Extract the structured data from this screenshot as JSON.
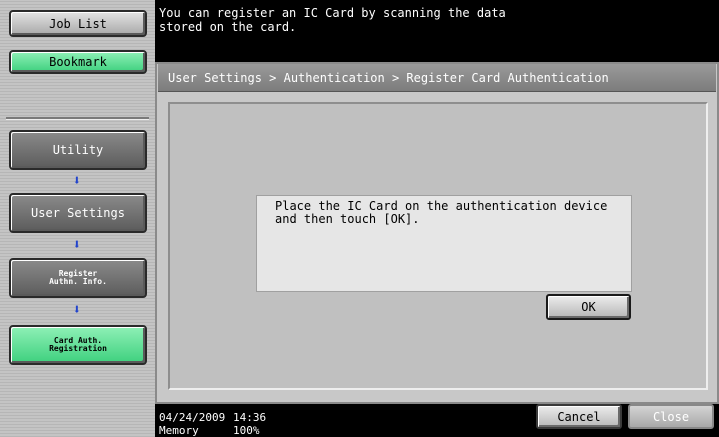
{
  "sidebar": {
    "job_list_label": "Job List",
    "bookmark_label": "Bookmark",
    "utility_label": "Utility",
    "user_settings_label": "User Settings",
    "register_authn_label": "Register\nAuthn. Info.",
    "card_auth_label": "Card Auth.\nRegistration",
    "arrow_glyph": "⬇"
  },
  "header": {
    "message": "You can register an IC Card by scanning the data\nstored on the card."
  },
  "breadcrumb": "User Settings > Authentication  > Register Card Authentication",
  "dialog": {
    "text": "Place the IC Card on the authentication device\nand then touch [OK].",
    "ok_label": "OK"
  },
  "status": {
    "date": "04/24/2009",
    "time": "14:36",
    "memory_label": "Memory",
    "memory_value": "100%"
  },
  "footer": {
    "cancel_label": "Cancel",
    "close_label": "Close"
  },
  "colors": {
    "active_green": "#3ed07e",
    "arrow_blue": "#2244cc"
  }
}
